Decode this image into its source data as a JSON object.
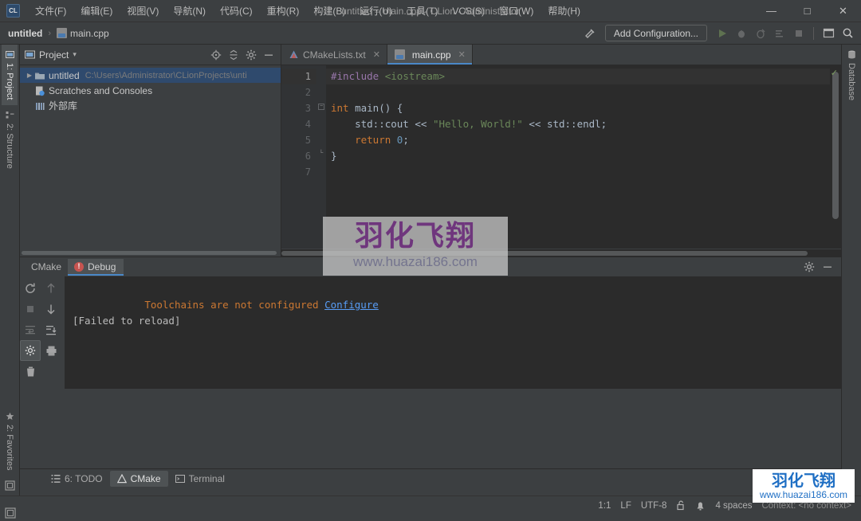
{
  "titlebar": {
    "logo": "CL",
    "window_title": "untitled – main.cpp - CLion - Administrator",
    "menus": [
      {
        "label": "文件(F)"
      },
      {
        "label": "编辑(E)"
      },
      {
        "label": "视图(V)"
      },
      {
        "label": "导航(N)"
      },
      {
        "label": "代码(C)"
      },
      {
        "label": "重构(R)"
      },
      {
        "label": "构建(B)"
      },
      {
        "label": "运行(U)"
      },
      {
        "label": "工具(T)"
      },
      {
        "label": "VCS(S)"
      },
      {
        "label": "窗口(W)"
      },
      {
        "label": "帮助(H)"
      }
    ],
    "minimize": "—",
    "maximize": "□",
    "close": "✕"
  },
  "toolbar": {
    "breadcrumb_project": "untitled",
    "breadcrumb_sep": "›",
    "breadcrumb_file": "main.cpp",
    "add_configuration": "Add Configuration...",
    "icons": [
      "build-hammer-icon",
      "run-icon",
      "debug-icon",
      "run-with-coverage-icon",
      "profile-icon",
      "stop-icon",
      "terminal-icon",
      "search-everywhere-icon"
    ]
  },
  "left_strip": {
    "tabs": [
      {
        "label": "1: Project",
        "icon": "project-folder-icon",
        "active": true
      },
      {
        "label": "2: Structure",
        "icon": "structure-icon",
        "active": false
      }
    ],
    "bottom_tabs": [
      {
        "label": "2: Favorites",
        "icon": "star-icon",
        "active": false
      }
    ],
    "bottom_icon": "layout-toggle-icon"
  },
  "right_strip": {
    "tabs": [
      {
        "label": "Database",
        "icon": "database-icon",
        "active": false
      }
    ]
  },
  "project_panel": {
    "title": "Project",
    "dropdown": "▾",
    "header_icons": [
      "locate-target-icon",
      "collapse-all-icon",
      "gear-icon",
      "hide-icon"
    ],
    "tree": [
      {
        "label": "untitled",
        "path": "C:\\Users\\Administrator\\CLionProjects\\unti",
        "icon": "folder-icon",
        "arrow": "▶",
        "selected": true,
        "indent": 0
      },
      {
        "label": "Scratches and Consoles",
        "path": "",
        "icon": "scratches-icon",
        "arrow": "",
        "selected": false,
        "indent": 1
      },
      {
        "label": "外部库",
        "path": "",
        "icon": "library-icon",
        "arrow": "",
        "selected": false,
        "indent": 1
      }
    ]
  },
  "editor": {
    "tabs": [
      {
        "label": "CMakeLists.txt",
        "icon": "cmake-file-icon",
        "active": false,
        "close": "✕"
      },
      {
        "label": "main.cpp",
        "icon": "cpp-file-icon",
        "active": true,
        "close": "✕"
      }
    ],
    "line_numbers": [
      "1",
      "2",
      "3",
      "4",
      "5",
      "6",
      "7"
    ],
    "code_lines": [
      {
        "n": 1,
        "tokens": [
          {
            "t": "#include",
            "c": "kw-dir"
          },
          {
            "t": " ",
            "c": "kw-plain"
          },
          {
            "t": "<iostream>",
            "c": "kw-inc"
          }
        ],
        "fold": false,
        "highlight": true
      },
      {
        "n": 2,
        "tokens": [],
        "fold": false,
        "highlight": false
      },
      {
        "n": 3,
        "tokens": [
          {
            "t": "int",
            "c": "kw-type"
          },
          {
            "t": " ",
            "c": "kw-plain"
          },
          {
            "t": "main",
            "c": "kw-plain"
          },
          {
            "t": "() {",
            "c": "kw-plain"
          }
        ],
        "fold": true,
        "highlight": false
      },
      {
        "n": 4,
        "tokens": [
          {
            "t": "    std::cout",
            "c": "kw-plain"
          },
          {
            "t": " << ",
            "c": "kw-op"
          },
          {
            "t": "\"Hello, World!\"",
            "c": "kw-str"
          },
          {
            "t": " << ",
            "c": "kw-op"
          },
          {
            "t": "std::endl;",
            "c": "kw-plain"
          }
        ],
        "fold": false,
        "highlight": false
      },
      {
        "n": 5,
        "tokens": [
          {
            "t": "    ",
            "c": "kw-plain"
          },
          {
            "t": "return",
            "c": "kw-type"
          },
          {
            "t": " ",
            "c": "kw-plain"
          },
          {
            "t": "0",
            "c": "kw-num"
          },
          {
            "t": ";",
            "c": "kw-plain"
          }
        ],
        "fold": false,
        "highlight": false
      },
      {
        "n": 6,
        "tokens": [
          {
            "t": "}",
            "c": "kw-plain"
          }
        ],
        "fold": true,
        "highlight": false
      },
      {
        "n": 7,
        "tokens": [],
        "fold": false,
        "highlight": false
      }
    ],
    "inspection_status": "✓"
  },
  "cmake_panel": {
    "label": "CMake",
    "debug_tab": "Debug",
    "error_badge": "!",
    "header_icons": [
      "gear-icon",
      "hide-panel-icon"
    ],
    "tool_icons": [
      {
        "name": "rerun-cmake-icon",
        "selected": false,
        "dim": false
      },
      {
        "name": "scroll-up-icon",
        "selected": false,
        "dim": true
      },
      {
        "name": "stop-icon",
        "selected": false,
        "dim": true
      },
      {
        "name": "scroll-down-icon",
        "selected": false,
        "dim": false
      },
      {
        "name": "soft-wrap-icon",
        "selected": false,
        "dim": false
      },
      {
        "name": "scroll-to-end-icon",
        "selected": true,
        "dim": false
      },
      {
        "name": "gear-icon",
        "selected": false,
        "dim": false
      },
      {
        "name": "print-icon",
        "selected": false,
        "dim": false
      },
      {
        "name": "trash-icon",
        "selected": false,
        "dim": false
      }
    ],
    "console": {
      "error_text": "Toolchains are not configured",
      "configure_link": "Configure",
      "blank_line": "",
      "failed_text": "[Failed to reload]"
    }
  },
  "bottom_tabs": [
    {
      "label": "6: TODO",
      "icon": "todo-icon",
      "active": false
    },
    {
      "label": "CMake",
      "icon": "cmake-warn-icon",
      "active": true
    },
    {
      "label": "Terminal",
      "icon": "terminal-icon",
      "active": false
    }
  ],
  "statusbar": {
    "caret": "1:1",
    "line_sep": "LF",
    "encoding": "UTF-8",
    "lock_icon": "lock-open-icon",
    "vcs_icon": "event-log-icon",
    "indent": "4 spaces",
    "context": "Context: <no context>",
    "layout_icon": "layout-icon"
  },
  "watermarks": {
    "center_cn": "羽化飞翔",
    "center_url": "www.huazai186.com",
    "corner_cn": "羽化飞翔",
    "corner_url": "www.huazai186.com"
  },
  "colors": {
    "accent": "#4a88c7",
    "error": "#c75450",
    "link": "#589df6",
    "bg": "#3c3f41",
    "editor_bg": "#2b2b2b"
  }
}
